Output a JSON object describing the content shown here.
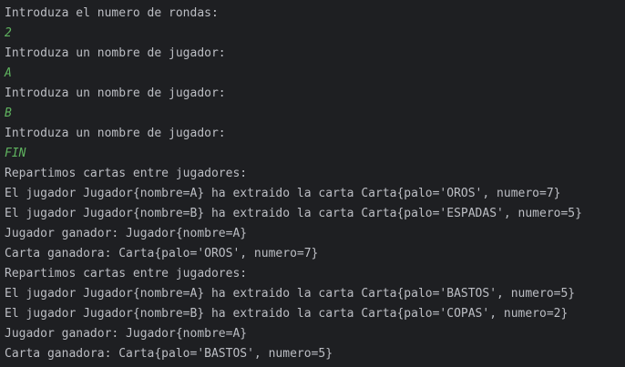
{
  "console": {
    "lines": [
      {
        "type": "output",
        "text": "Introduza el numero de rondas:"
      },
      {
        "type": "input",
        "text": "2"
      },
      {
        "type": "output",
        "text": "Introduza un nombre de jugador:"
      },
      {
        "type": "input",
        "text": "A"
      },
      {
        "type": "output",
        "text": "Introduza un nombre de jugador:"
      },
      {
        "type": "input",
        "text": "B"
      },
      {
        "type": "output",
        "text": "Introduza un nombre de jugador:"
      },
      {
        "type": "input",
        "text": "FIN"
      },
      {
        "type": "output",
        "text": "Repartimos cartas entre jugadores:"
      },
      {
        "type": "output",
        "text": "El jugador Jugador{nombre=A} ha extraido la carta Carta{palo='OROS', numero=7}"
      },
      {
        "type": "output",
        "text": "El jugador Jugador{nombre=B} ha extraido la carta Carta{palo='ESPADAS', numero=5}"
      },
      {
        "type": "output",
        "text": "Jugador ganador: Jugador{nombre=A}"
      },
      {
        "type": "output",
        "text": "Carta ganadora: Carta{palo='OROS', numero=7}"
      },
      {
        "type": "output",
        "text": "Repartimos cartas entre jugadores:"
      },
      {
        "type": "output",
        "text": "El jugador Jugador{nombre=A} ha extraido la carta Carta{palo='BASTOS', numero=5}"
      },
      {
        "type": "output",
        "text": "El jugador Jugador{nombre=B} ha extraido la carta Carta{palo='COPAS', numero=2}"
      },
      {
        "type": "output",
        "text": "Jugador ganador: Jugador{nombre=A}"
      },
      {
        "type": "output",
        "text": "Carta ganadora: Carta{palo='BASTOS', numero=5}"
      }
    ],
    "colors": {
      "background": "#1e1f22",
      "output_text": "#bcbec4",
      "input_text": "#5fb25f"
    }
  }
}
